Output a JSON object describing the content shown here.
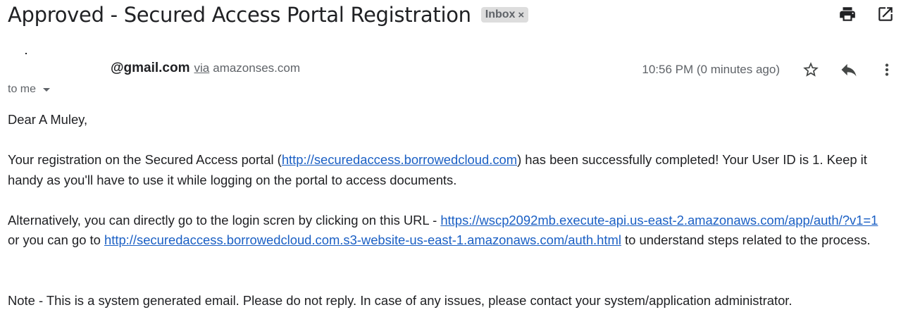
{
  "email": {
    "subject": "Approved - Secured Access Portal Registration",
    "label_chip": {
      "text": "Inbox",
      "close": "×"
    },
    "sender": {
      "email": "@gmail.com",
      "via_label": "via",
      "via_domain": "amazonses.com"
    },
    "timestamp": "10:56 PM (0 minutes ago)",
    "recipient_label": "to me",
    "body": {
      "greeting": "Dear A Muley,",
      "p1_before_link": "Your registration on the Secured Access portal (",
      "p1_link": "http://securedaccess.borrowedcloud.com",
      "p1_after_link": ") has been successfully completed! Your User ID is 1. Keep it handy as you'll have to use it while logging on the portal to access documents.",
      "p2_before_link1": "Alternatively, you can directly go to the login scren by clicking on this URL - ",
      "p2_link1": "https://wscp2092mb.execute-api.us-east-2.amazonaws.com/app/auth/?v1=1",
      "p2_between_links": " or you can go to ",
      "p2_link2": "http://securedaccess.borrowedcloud.com.s3-website-us-east-1.amazonaws.com/auth.html",
      "p2_after_link2": " to understand steps related to the process.",
      "note": "Note - This is a system generated email. Please do not reply. In case of any issues, please contact your system/application administrator."
    }
  },
  "icons": {
    "print": "print-icon",
    "open_new_window": "open-in-new-window-icon",
    "star": "star-icon",
    "reply": "reply-icon",
    "more": "more-vertical-icon",
    "recipient_dropdown": "caret-down-icon"
  },
  "colors": {
    "text": "#202124",
    "secondary_text": "#5f6368",
    "link": "#1a5fc4",
    "chip_bg": "#dddddd"
  }
}
